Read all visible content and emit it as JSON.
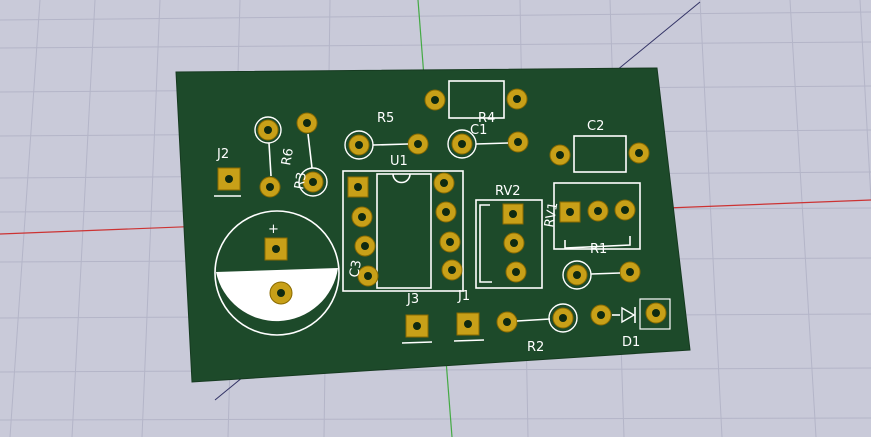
{
  "scene": {
    "background_color": "#c9cad9",
    "grid_color": "#b5b6c8",
    "board_color": "#1d4a2a",
    "pad_color": "#c8a018",
    "silk_color": "#ffffff",
    "x_axis_color": "#cc3333",
    "y_axis_color": "#44aa44",
    "z_axis_color": "#333366"
  },
  "components": {
    "J2": "J2",
    "R6": "R6",
    "R3": "R3",
    "R5": "R5",
    "R4": "R4",
    "C1": "C1",
    "C2": "C2",
    "U1": "U1",
    "RV2": "RV2",
    "RV1": "RV1",
    "R1": "R1",
    "C3": "C3",
    "J3": "J3",
    "J1": "J1",
    "R2": "R2",
    "D1": "D1",
    "C3_polarity": "+"
  }
}
